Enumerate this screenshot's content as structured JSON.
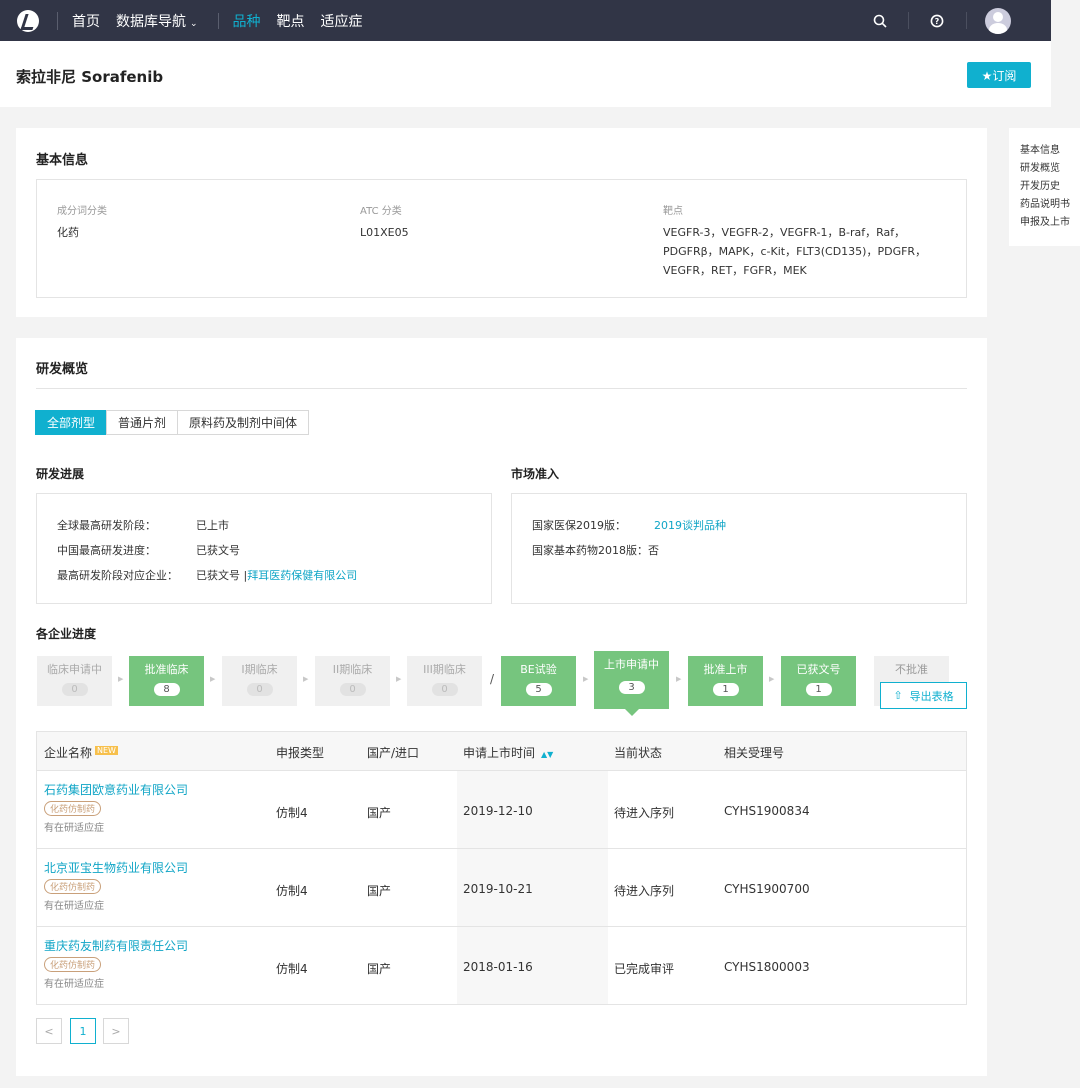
{
  "nav": {
    "items": [
      "首页",
      "数据库导航",
      "品种",
      "靶点",
      "适应症"
    ],
    "active": "品种"
  },
  "header": {
    "title": "索拉非尼 Sorafenib",
    "subscribe": "★订阅"
  },
  "side_anchor": [
    "基本信息",
    "研发概览",
    "开发历史",
    "药品说明书",
    "申报及上市"
  ],
  "basic": {
    "title": "基本信息",
    "col1_label": "成分词分类",
    "col1_value": "化药",
    "col2_label": "ATC 分类",
    "col2_value": "L01XE05",
    "col3_label": "靶点",
    "col3_lines": [
      "VEGFR-3，VEGFR-2，VEGFR-1，B-raf，Raf，",
      "PDGFRβ，MAPK，c-Kit，FLT3(CD135)，PDGFR，",
      "VEGFR，RET，FGFR，MEK"
    ]
  },
  "overview": {
    "title": "研发概览",
    "tabs": [
      "全部剂型",
      "普通片剂",
      "原料药及制剂中间体"
    ],
    "progress_title": "研发进展",
    "market_title": "市场准入",
    "progress": {
      "r1_label": "全球最高研发阶段：",
      "r1_value": "已上市",
      "r2_label": "中国最高研发进度：",
      "r2_value": "已获文号",
      "r3_label": "最高研发阶段对应企业：",
      "r3_value": "已获文号 | ",
      "r3_link": "拜耳医药保健有限公司"
    },
    "market": {
      "r1_label": "国家医保2019版：",
      "r1_link": "2019谈判品种",
      "r2_label": "国家基本药物2018版：",
      "r2_value": "否"
    },
    "company_progress_title": "各企业进度",
    "stages": [
      {
        "name": "临床申请中",
        "count": "0"
      },
      {
        "name": "批准临床",
        "count": "8"
      },
      {
        "name": "I期临床",
        "count": "0"
      },
      {
        "name": "II期临床",
        "count": "0"
      },
      {
        "name": "III期临床",
        "count": "0"
      },
      {
        "name": "BE试验",
        "count": "5"
      },
      {
        "name": "上市申请中",
        "count": "3"
      },
      {
        "name": "批准上市",
        "count": "1"
      },
      {
        "name": "已获文号",
        "count": "1"
      },
      {
        "name": "不批准",
        "count": ""
      }
    ],
    "stage_slash": "/",
    "export": "导出表格",
    "table": {
      "headers": [
        "企业名称",
        "申报类型",
        "国产/进口",
        "申请上市时间",
        "当前状态",
        "相关受理号"
      ],
      "new_badge": "NEW",
      "rows": [
        {
          "company": "石药集团欧意药业有限公司",
          "tag": "化药仿制药",
          "note": "有在研适应症",
          "type": "仿制4",
          "origin": "国产",
          "date": "2019-12-10",
          "status": "待进入序列",
          "acceptance": "CYHS1900834"
        },
        {
          "company": "北京亚宝生物药业有限公司",
          "tag": "化药仿制药",
          "note": "有在研适应症",
          "type": "仿制4",
          "origin": "国产",
          "date": "2019-10-21",
          "status": "待进入序列",
          "acceptance": "CYHS1900700"
        },
        {
          "company": "重庆药友制药有限责任公司",
          "tag": "化药仿制药",
          "note": "有在研适应症",
          "type": "仿制4",
          "origin": "国产",
          "date": "2018-01-16",
          "status": "已完成审评",
          "acceptance": "CYHS1800003"
        }
      ]
    },
    "pager": {
      "prev": "<",
      "current": "1",
      "next": ">"
    }
  },
  "colors": {
    "accent": "#10b0cf",
    "topbar": "#313546",
    "stage_green": "#76c57e"
  }
}
